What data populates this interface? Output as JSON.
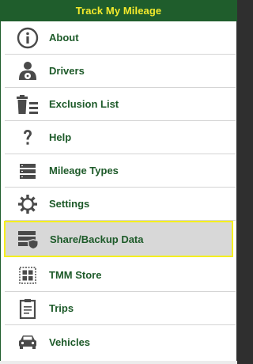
{
  "header": {
    "title": "Track My Mileage"
  },
  "menu": {
    "items": [
      {
        "label": "About",
        "icon": "info-icon"
      },
      {
        "label": "Drivers",
        "icon": "driver-icon"
      },
      {
        "label": "Exclusion List",
        "icon": "trash-list-icon"
      },
      {
        "label": "Help",
        "icon": "question-icon"
      },
      {
        "label": "Mileage Types",
        "icon": "server-list-icon"
      },
      {
        "label": "Settings",
        "icon": "gear-icon"
      },
      {
        "label": "Share/Backup Data",
        "icon": "backup-shield-icon",
        "selected": true
      },
      {
        "label": "TMM Store",
        "icon": "store-grid-icon"
      },
      {
        "label": "Trips",
        "icon": "clipboard-icon"
      },
      {
        "label": "Vehicles",
        "icon": "car-icon"
      }
    ]
  },
  "colors": {
    "header_bg": "#1f5d2c",
    "header_text": "#f3ea2c",
    "label_text": "#1d5a29",
    "selected_bg": "#d8d8d8",
    "selected_border": "#f5ef1f"
  }
}
